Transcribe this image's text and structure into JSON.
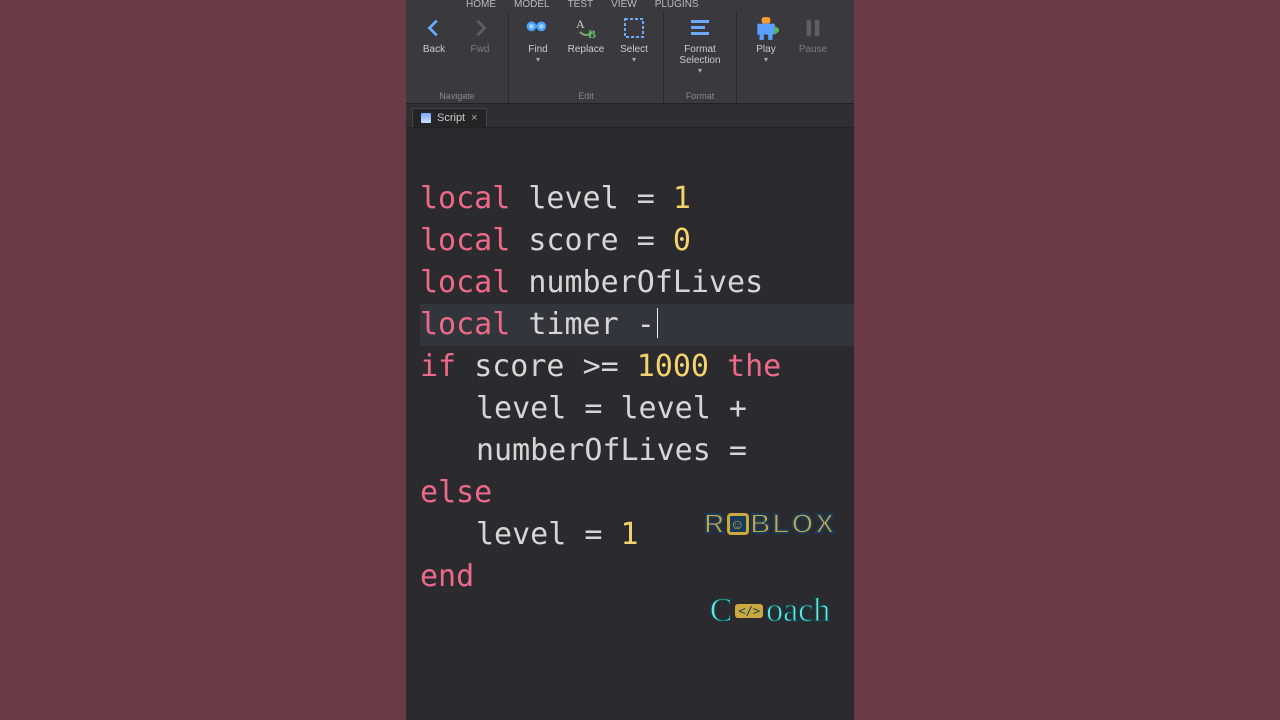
{
  "menubar": {
    "items": [
      "HOME",
      "MODEL",
      "TEST",
      "VIEW",
      "PLUGINS"
    ]
  },
  "ribbon": {
    "groups": [
      {
        "label": "Navigate",
        "buttons": [
          {
            "name": "back-button",
            "label": "Back",
            "icon": "chevron-left-icon"
          },
          {
            "name": "fwd-button",
            "label": "Fwd",
            "icon": "chevron-right-icon"
          }
        ]
      },
      {
        "label": "Edit",
        "buttons": [
          {
            "name": "find-button",
            "label": "Find",
            "icon": "find-icon",
            "dropdown": true
          },
          {
            "name": "replace-button",
            "label": "Replace",
            "icon": "replace-icon"
          },
          {
            "name": "select-button",
            "label": "Select",
            "icon": "select-icon",
            "dropdown": true
          }
        ]
      },
      {
        "label": "Format",
        "buttons": [
          {
            "name": "format-selection-button",
            "label": "Format Selection",
            "icon": "format-icon",
            "dropdown": true
          }
        ]
      },
      {
        "label": "",
        "buttons": [
          {
            "name": "play-button",
            "label": "Play",
            "icon": "play-icon",
            "dropdown": true
          },
          {
            "name": "pause-button",
            "label": "Pause",
            "icon": "pause-icon"
          }
        ]
      }
    ]
  },
  "tab": {
    "label": "Script",
    "close": "×"
  },
  "code": {
    "kw_local": "local",
    "kw_if": "if",
    "kw_then": "the",
    "kw_else": "else",
    "kw_end": "end",
    "id_level": "level",
    "id_score": "score",
    "id_numLives": "numberOfLives",
    "id_timer": "timer",
    "eq": "=",
    "gte": ">=",
    "plus": "+",
    "dash": "-",
    "n1": "1",
    "n0": "0",
    "n1000": "1000"
  },
  "logo": {
    "top_pre": "R",
    "top_face": "☺",
    "top_post": "BLOX",
    "bottom_pre": "C",
    "code_badge": "</>",
    "bottom_post": "oach"
  }
}
